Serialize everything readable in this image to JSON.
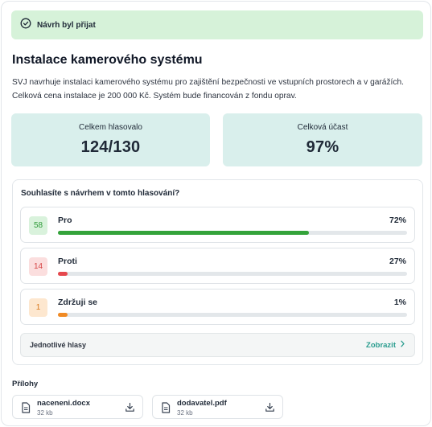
{
  "banner": {
    "text": "Návrh byl přijat",
    "icon": "check-circle-icon"
  },
  "proposal": {
    "title": "Instalace kamerového systému",
    "description": "SVJ navrhuje instalaci kamerového systému pro zajištění bezpečnosti ve vstupních prostorech a v garážích. Celková cena instalace je 200 000 Kč. Systém bude financován z fondu oprav."
  },
  "stats": {
    "voted_label": "Celkem hlasovalo",
    "voted_value": "124/130",
    "turnout_label": "Celková účast",
    "turnout_value": "97%"
  },
  "poll": {
    "question": "Souhlasíte s návrhem v tomto hlasování?",
    "options": [
      {
        "count": "58",
        "label": "Pro",
        "percent": "72%",
        "fraction": 0.72,
        "color": "#34a33a",
        "badge_bg": "#d9f2dc",
        "badge_fg": "#2f9a39"
      },
      {
        "count": "14",
        "label": "Proti",
        "percent": "27%",
        "fraction": 0.027,
        "color": "#e5484d",
        "badge_bg": "#fbdede",
        "badge_fg": "#d64545"
      },
      {
        "count": "1",
        "label": "Zdržuji se",
        "percent": "1%",
        "fraction": 0.027,
        "color": "#f08a24",
        "badge_bg": "#fde7cf",
        "badge_fg": "#d9791f"
      }
    ],
    "individual_votes_label": "Jednotlivé hlasy",
    "show_label": "Zobrazit"
  },
  "attachments": {
    "heading": "Přílohy",
    "files": [
      {
        "name": "naceneni.docx",
        "size": "32 kb"
      },
      {
        "name": "dodavatel.pdf",
        "size": "32 kb"
      }
    ]
  }
}
